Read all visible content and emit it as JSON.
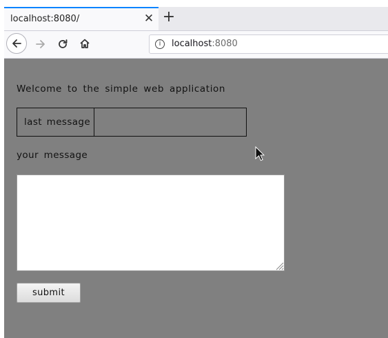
{
  "browser": {
    "tab": {
      "title": "localhost:8080/",
      "close_icon": "close-icon"
    },
    "new_tab_icon": "plus-icon",
    "nav": {
      "back_icon": "arrow-left-icon",
      "forward_icon": "arrow-right-icon",
      "reload_icon": "reload-icon",
      "home_icon": "home-icon"
    },
    "url": {
      "host": "localhost",
      "port": ":8080",
      "info_icon": "info-icon"
    }
  },
  "page": {
    "welcome_text": "Welcome to the simple web application",
    "last_message": {
      "label": "last message",
      "value": ""
    },
    "your_message_label": "your message",
    "message_input": {
      "value": "",
      "placeholder": ""
    },
    "submit_label": "submit"
  },
  "colors": {
    "page_background": "#808080",
    "tab_accent": "#0a84ff",
    "chrome_background": "#f9f9fb"
  }
}
